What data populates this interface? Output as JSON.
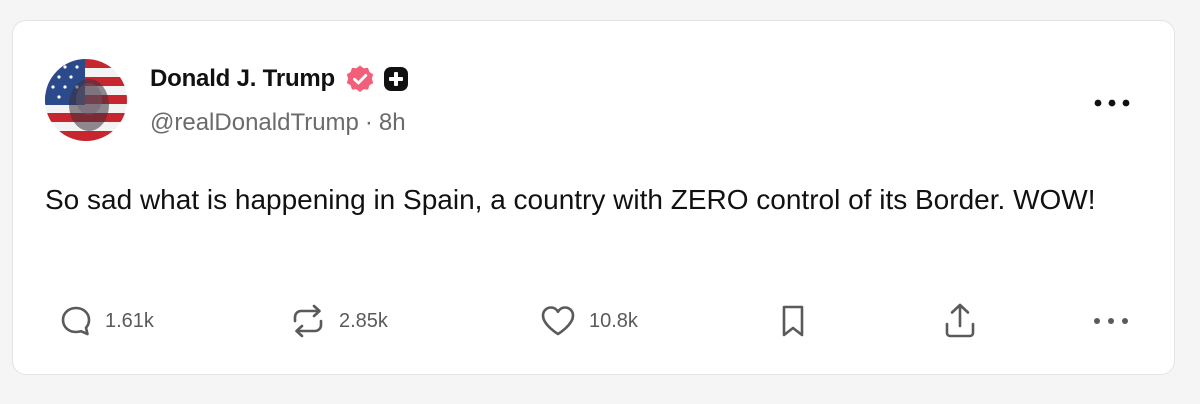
{
  "post": {
    "author": {
      "display_name": "Donald J. Trump",
      "handle": "@realDonaldTrump",
      "time_separator": "·",
      "time_ago": "8h",
      "verified_color": "#f25f7a",
      "subscription_badge_color": "#111111"
    },
    "text": "So sad what is happening in Spain, a country with ZERO control of its Border. WOW!",
    "actions": {
      "replies": "1.61k",
      "reposts": "2.85k",
      "likes": "10.8k"
    },
    "icons": {
      "reply": "speech-bubble-icon",
      "repost": "repost-arrows-icon",
      "like": "heart-icon",
      "bookmark": "bookmark-icon",
      "share": "share-upload-icon",
      "more": "more-horizontal-icon"
    }
  }
}
